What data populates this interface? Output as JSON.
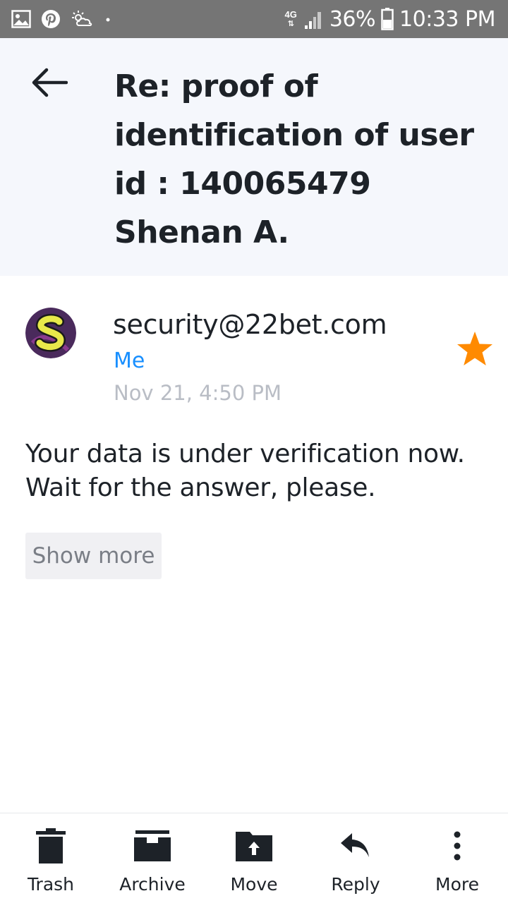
{
  "status_bar": {
    "left_icons": [
      "gallery-icon",
      "pinterest-icon",
      "weather-icon",
      "dot-icon"
    ],
    "network_type": "4G",
    "signal_icon": "signal-icon",
    "battery_percent": "36%",
    "battery_icon": "battery-icon",
    "time": "10:33 PM"
  },
  "header": {
    "back_icon": "back-arrow-icon",
    "subject": "Re: proof of identification of user id : 140065479 Shenan A."
  },
  "message": {
    "avatar_letter": "S",
    "sender": "security@22bet.com",
    "recipient": "Me",
    "date": "Nov 21, 4:50 PM",
    "starred": true,
    "star_color": "#ff8a00",
    "body": "Your data is under verification now. Wait for the answer, please.",
    "show_more_label": "Show more"
  },
  "toolbar": {
    "items": [
      {
        "label": "Trash",
        "icon": "trash-icon"
      },
      {
        "label": "Archive",
        "icon": "archive-icon"
      },
      {
        "label": "Move",
        "icon": "move-folder-icon"
      },
      {
        "label": "Reply",
        "icon": "reply-icon"
      },
      {
        "label": "More",
        "icon": "more-vertical-icon"
      }
    ]
  },
  "colors": {
    "header_bg": "#f5f7fc",
    "status_bar_bg": "#757575",
    "link_blue": "#188fff",
    "date_gray": "#b9bdc5"
  }
}
